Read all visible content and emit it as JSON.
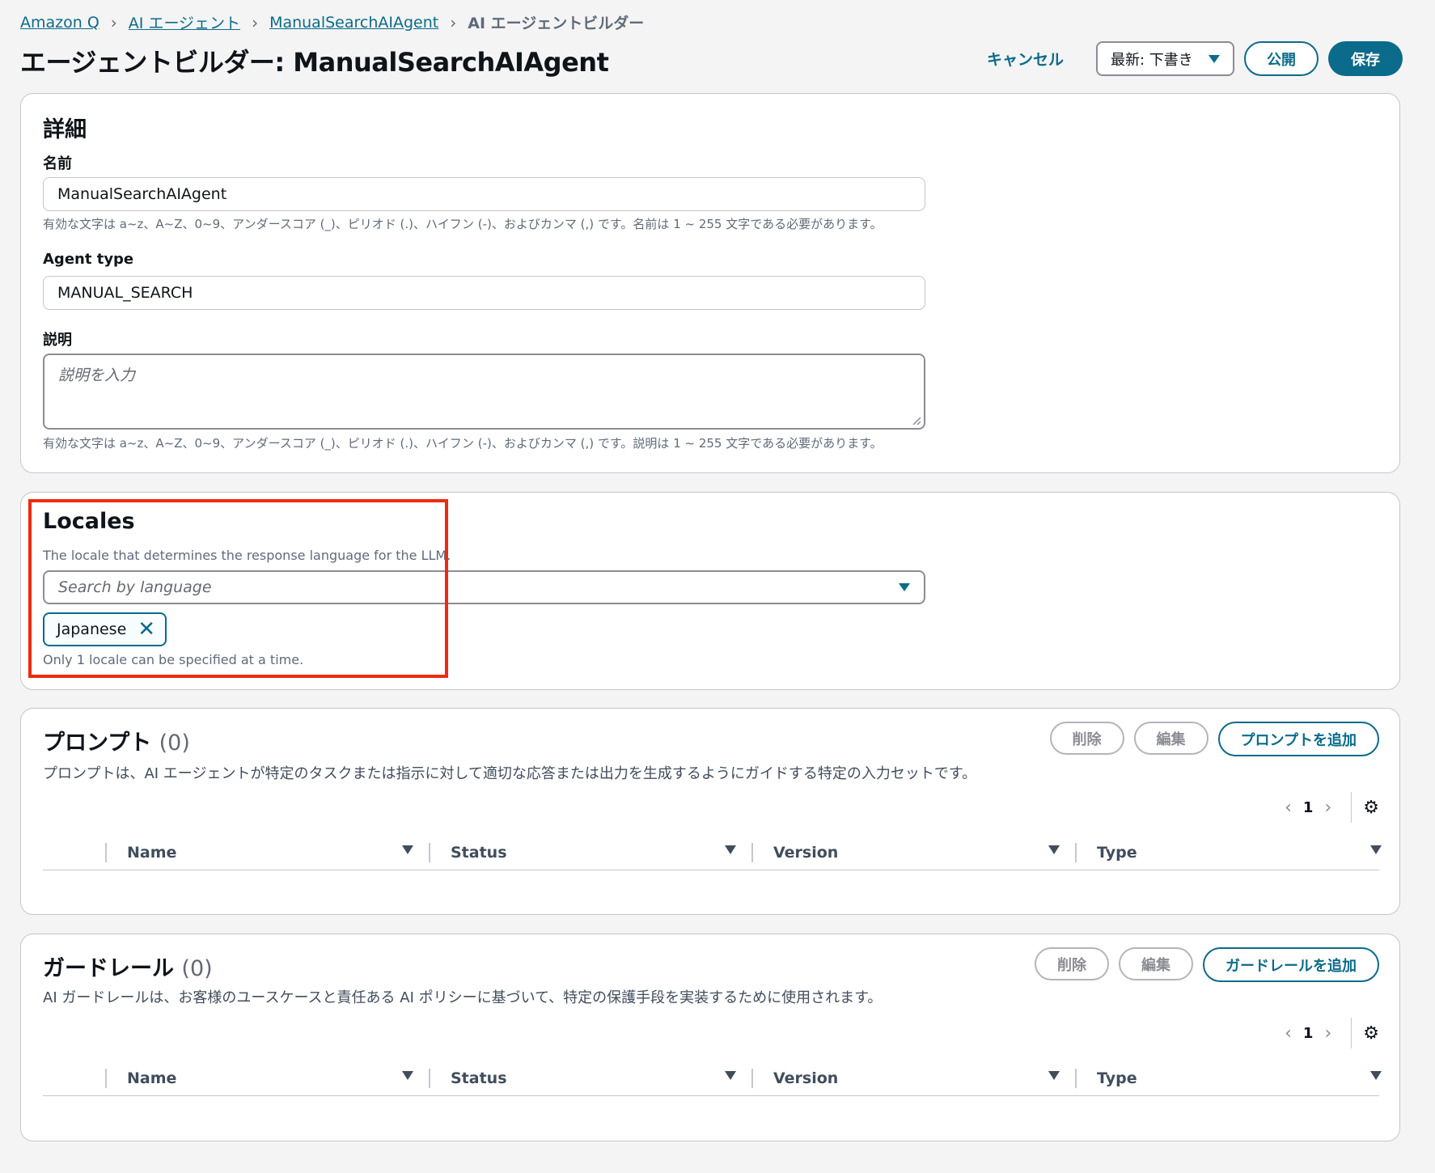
{
  "breadcrumb": {
    "items": [
      "Amazon Q",
      "AI エージェント",
      "ManualSearchAIAgent"
    ],
    "current": "AI エージェントビルダー"
  },
  "page": {
    "title": "エージェントビルダー: ManualSearchAIAgent"
  },
  "header_actions": {
    "cancel": "キャンセル",
    "version_select": "最新: 下書き",
    "publish": "公開",
    "save": "保存"
  },
  "details": {
    "title": "詳細",
    "name_label": "名前",
    "name_value": "ManualSearchAIAgent",
    "name_hint": "有効な文字は a~z、A~Z、0~9、アンダースコア (_)、ピリオド (.)、ハイフン (-)、およびカンマ (,) です。名前は 1 ~ 255 文字である必要があります。",
    "agent_type_label": "Agent type",
    "agent_type_value": "MANUAL_SEARCH",
    "description_label": "説明",
    "description_placeholder": "説明を入力",
    "description_hint": "有効な文字は a~z、A~Z、0~9、アンダースコア (_)、ピリオド (.)、ハイフン (-)、およびカンマ (,) です。説明は 1 ~ 255 文字である必要があります。"
  },
  "locales": {
    "title": "Locales",
    "description": "The locale that determines the response language for the LLM.",
    "search_placeholder": "Search by language",
    "selected": "Japanese",
    "constraint": "Only 1 locale can be specified at a time."
  },
  "prompts": {
    "title": "プロンプト",
    "count": "(0)",
    "delete": "削除",
    "edit": "編集",
    "add": "プロンプトを追加",
    "description": "プロンプトは、AI エージェントが特定のタスクまたは指示に対して適切な応答または出力を生成するようにガイドする特定の入力セットです。",
    "page": "1",
    "columns": [
      "Name",
      "Status",
      "Version",
      "Type"
    ]
  },
  "guardrails": {
    "title": "ガードレール",
    "count": "(0)",
    "delete": "削除",
    "edit": "編集",
    "add": "ガードレールを追加",
    "description": "AI ガードレールは、お客様のユースケースと責任ある AI ポリシーに基づいて、特定の保護手段を実装するために使用されます。",
    "page": "1",
    "columns": [
      "Name",
      "Status",
      "Version",
      "Type"
    ]
  },
  "icons": [
    "chevron-right-icon",
    "caret-down-icon",
    "close-icon",
    "chevron-left-icon",
    "gear-icon",
    "sort-icon",
    "resize-grip-icon"
  ],
  "colors": {
    "accent": "#0b6b8a",
    "highlight": "#ee2b0e"
  }
}
